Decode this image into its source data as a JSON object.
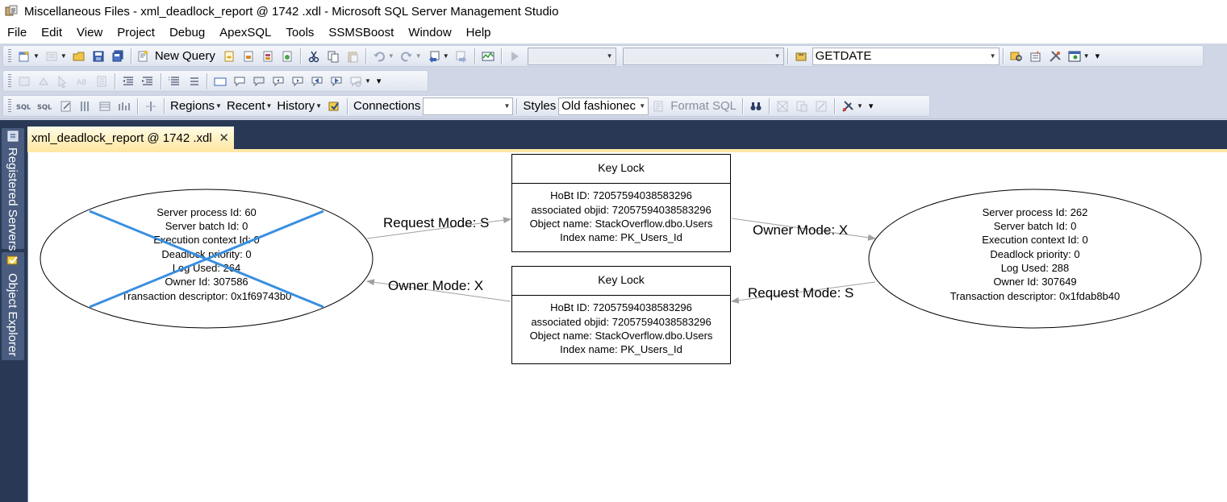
{
  "window": {
    "title": "Miscellaneous Files - xml_deadlock_report @ 1742 .xdl - Microsoft SQL Server Management Studio"
  },
  "menu": [
    "File",
    "Edit",
    "View",
    "Project",
    "Debug",
    "ApexSQL",
    "Tools",
    "SSMSBoost",
    "Window",
    "Help"
  ],
  "toolbar1": {
    "new_query_label": "New Query",
    "database_combo": "",
    "target_combo": "",
    "function_combo": "GETDATE"
  },
  "toolbar3": {
    "regions_label": "Regions",
    "recent_label": "Recent",
    "history_label": "History",
    "connections_label": "Connections",
    "connections_value": "",
    "styles_label": "Styles",
    "styles_value": "Old fashionec",
    "format_sql_label": "Format SQL"
  },
  "tabs": [
    {
      "label": "xml_deadlock_report @ 1742 .xdl",
      "close": "✕"
    }
  ],
  "sidebar": {
    "registered_servers": "Registered Servers",
    "object_explorer": "Object Explorer"
  },
  "graph": {
    "victim_process": {
      "lines": [
        "Server process Id: 60",
        "Server batch Id: 0",
        "Execution context Id: 0",
        "Deadlock priority: 0",
        "Log Used: 264",
        "Owner Id: 307586",
        "Transaction descriptor: 0x1f69743b0"
      ],
      "is_victim": true,
      "cross_color": "#3a8fe0"
    },
    "other_process": {
      "lines": [
        "Server process Id: 262",
        "Server batch Id: 0",
        "Execution context Id: 0",
        "Deadlock priority: 0",
        "Log Used: 288",
        "Owner Id: 307649",
        "Transaction descriptor: 0x1fdab8b40"
      ]
    },
    "lock_top": {
      "title": "Key Lock",
      "lines": [
        "HoBt ID: 72057594038583296",
        "associated objid: 72057594038583296",
        "Object name: StackOverflow.dbo.Users",
        "Index name: PK_Users_Id"
      ]
    },
    "lock_bottom": {
      "title": "Key Lock",
      "lines": [
        "HoBt ID: 72057594038583296",
        "associated objid: 72057594038583296",
        "Object name: StackOverflow.dbo.Users",
        "Index name: PK_Users_Id"
      ]
    },
    "edges": {
      "victim_request": "Request Mode: S",
      "top_owner": "Owner Mode: X",
      "bottom_owner": "Owner Mode: X",
      "other_request": "Request Mode: S"
    }
  }
}
